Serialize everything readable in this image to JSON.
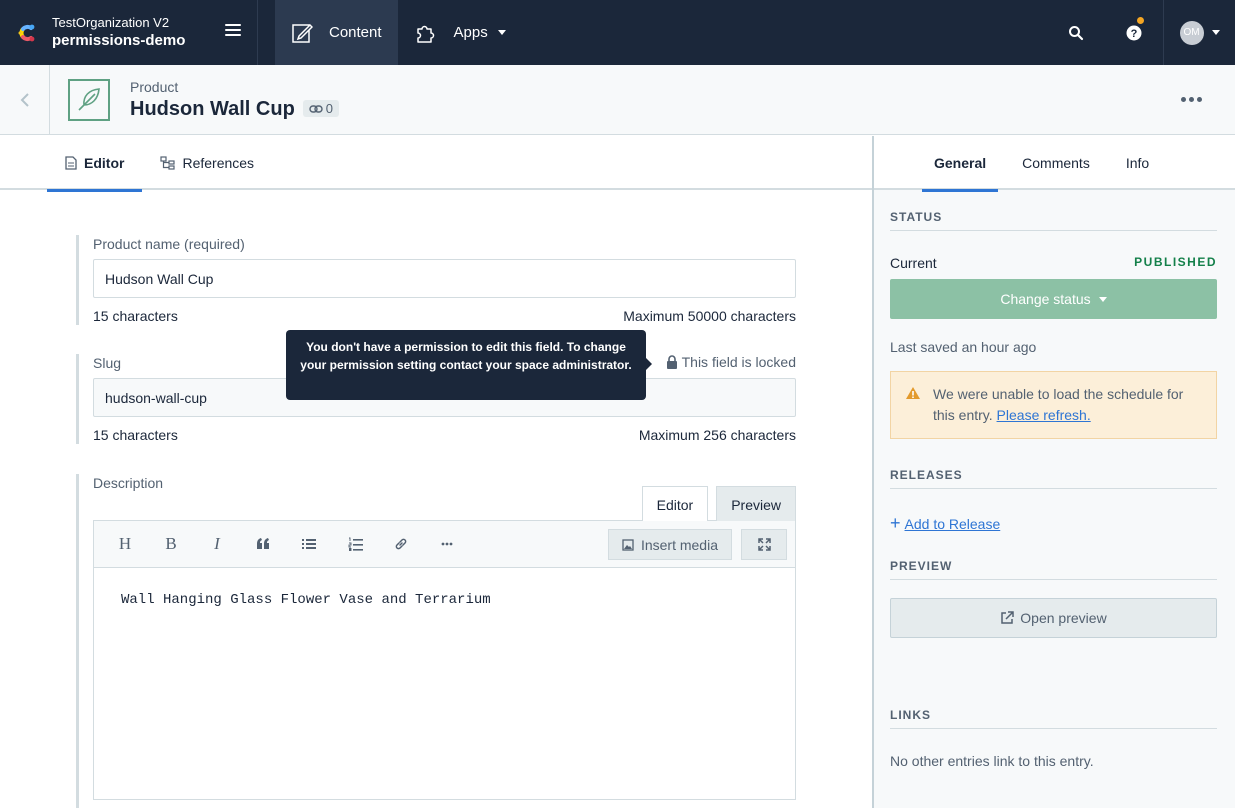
{
  "nav": {
    "org_name": "TestOrganization V2",
    "space_name": "permissions-demo",
    "content_label": "Content",
    "apps_label": "Apps",
    "avatar_initials": "OM"
  },
  "entry": {
    "content_type": "Product",
    "title": "Hudson Wall Cup",
    "reference_count": "0"
  },
  "editor_tabs": [
    "Editor",
    "References"
  ],
  "fields": {
    "product_name": {
      "label": "Product name (required)",
      "value": "Hudson Wall Cup",
      "char_count": "15 characters",
      "max": "Maximum 50000 characters"
    },
    "slug": {
      "label": "Slug",
      "value": "hudson-wall-cup",
      "char_count": "15 characters",
      "max": "Maximum 256 characters",
      "locked_text": "This field is locked",
      "tooltip": "You don't have a permission to edit this field. To change your permission setting contact your space administrator."
    },
    "description": {
      "label": "Description",
      "mode_editor": "Editor",
      "mode_preview": "Preview",
      "insert_media": "Insert media",
      "value": "Wall Hanging Glass Flower Vase and Terrarium",
      "toolbar": [
        "H",
        "B",
        "I"
      ]
    }
  },
  "sidebar": {
    "tabs": [
      "General",
      "Comments",
      "Info"
    ],
    "status": {
      "heading": "STATUS",
      "current_label": "Current",
      "current_value": "PUBLISHED",
      "change_button": "Change status",
      "last_saved": "Last saved an hour ago",
      "warning_text": "We were unable to load the schedule for this entry. ",
      "warning_link": "Please refresh."
    },
    "releases": {
      "heading": "RELEASES",
      "add_label": "Add to Release"
    },
    "preview": {
      "heading": "PREVIEW",
      "button": "Open preview"
    },
    "links": {
      "heading": "LINKS",
      "empty_text": "No other entries link to this entry."
    }
  },
  "colors": {
    "navbar": "#1b273a",
    "accent": "#2e75d4",
    "published": "#14804a",
    "change_status_bg": "#8cc1a5",
    "warning_bg": "#fcefd9"
  }
}
